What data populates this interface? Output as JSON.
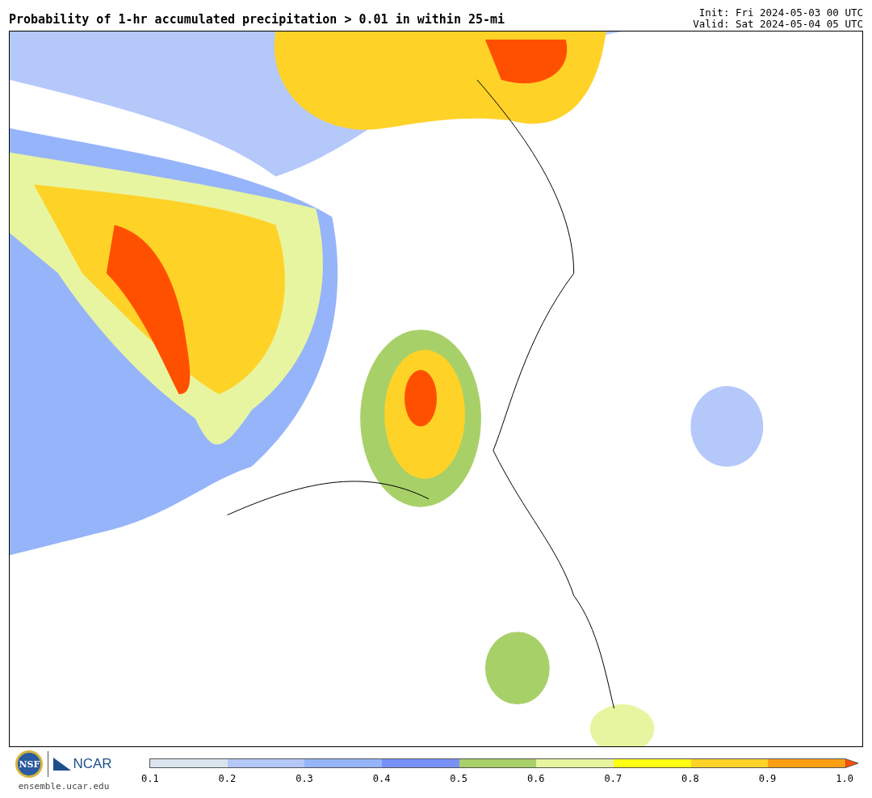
{
  "header": {
    "title": "Probability of 1-hr accumulated precipitation > 0.01 in within 25-mi",
    "init": "Init: Fri 2024-05-03 00 UTC",
    "valid": "Valid: Sat 2024-05-04 05 UTC"
  },
  "footer": {
    "nsf": "NSF",
    "ncar": "NCAR",
    "url": "ensemble.ucar.edu"
  },
  "colorbar": {
    "bins": [
      {
        "kind": "bin",
        "color": "#dae4ee"
      },
      {
        "kind": "bin",
        "color": "#b4c8fa"
      },
      {
        "kind": "bin",
        "color": "#96b4fa"
      },
      {
        "kind": "bin",
        "color": "#7890fa"
      },
      {
        "kind": "bin",
        "color": "#a8d068"
      },
      {
        "kind": "bin",
        "color": "#e8f5a0"
      },
      {
        "kind": "bin",
        "color": "#ffff14"
      },
      {
        "kind": "bin",
        "color": "#ffd228"
      },
      {
        "kind": "bin",
        "color": "#ffa014"
      },
      {
        "kind": "extend",
        "color": "#ff5000"
      }
    ],
    "ticks": [
      "0.1",
      "0.2",
      "0.3",
      "0.4",
      "0.5",
      "0.6",
      "0.7",
      "0.8",
      "0.9",
      "1.0"
    ]
  }
}
